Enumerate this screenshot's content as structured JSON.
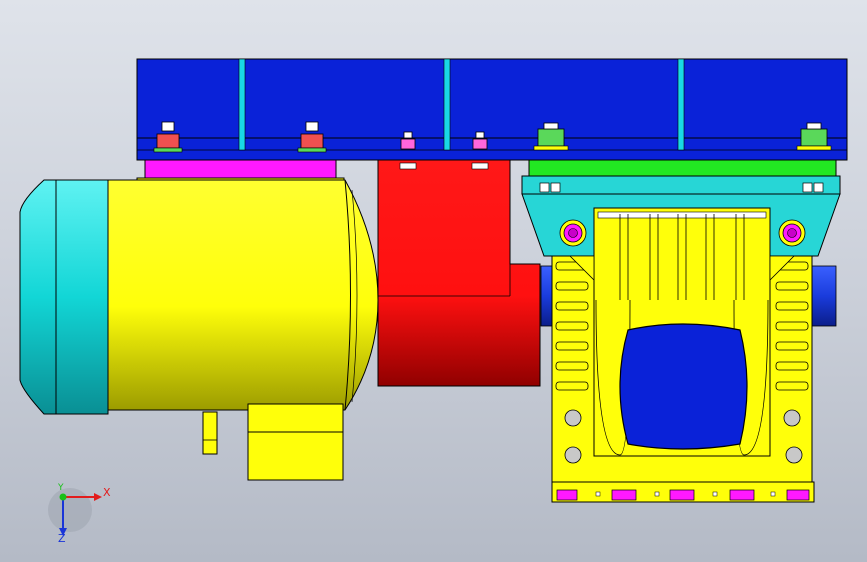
{
  "viewport": {
    "background_top": "#dfe3ea",
    "background_bottom": "#b4bac6"
  },
  "model": {
    "parts": {
      "top_plate": "#0a22d8",
      "top_plate_ribs": "#19d9e6",
      "motor_cap": "#12d6d6",
      "motor_body": "#ffff0a",
      "motor_mount": "#ff19ff",
      "coupling_housing": "#ff1010",
      "gearbox_body": "#ffff0a",
      "gearbox_flange": "#27d6d6",
      "gearbox_mount": "#22e822",
      "gearbox_window": "#0a22d8",
      "output_shaft": "#1a3cdc",
      "bolt_heads": "#ff19ff"
    },
    "fastener_colors": [
      "#f05050",
      "#5ad85a",
      "#ff66dd",
      "#ffffff"
    ]
  },
  "triad": {
    "x_label": "X",
    "y_label": "Y",
    "z_label": "Z",
    "x_color": "#e21c1c",
    "y_color": "#19c019",
    "z_color": "#1a35d8"
  }
}
